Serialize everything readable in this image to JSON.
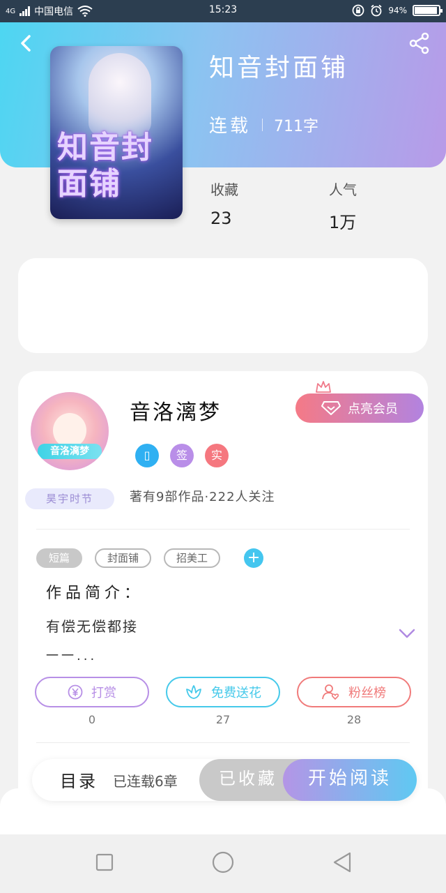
{
  "status_bar": {
    "network": "4G",
    "carrier": "中国电信",
    "time": "15:23",
    "battery": "94%"
  },
  "book": {
    "title": "知音封面铺",
    "status": "连载",
    "word_count": "711字",
    "cover_title": "知音封面铺",
    "stats": [
      {
        "label": "收藏",
        "value": "23"
      },
      {
        "label": "人气",
        "value": "1万"
      }
    ]
  },
  "author": {
    "name": "音洛漓梦",
    "title_badge": "昊宇时节",
    "avatar_label": "音洛漓梦",
    "vip_button": "点亮会员",
    "badges": [
      {
        "text": "▯",
        "color": "#2fb0f2"
      },
      {
        "text": "签",
        "color": "#b98ee8"
      },
      {
        "text": "实",
        "color": "#f5777f"
      }
    ],
    "description": "著有9部作品·222人关注"
  },
  "tags": [
    "短篇",
    "封面铺",
    "招美工"
  ],
  "intro": {
    "title": "作品简介：",
    "text": "有偿无偿都接",
    "more": "一一..."
  },
  "actions": [
    {
      "label": "打赏",
      "count": "0",
      "color": "#b78fe6",
      "icon": "yen-icon"
    },
    {
      "label": "免费送花",
      "count": "27",
      "color": "#45c9ea",
      "icon": "flower-icon"
    },
    {
      "label": "粉丝榜",
      "count": "28",
      "color": "#f07a7a",
      "icon": "fan-icon"
    }
  ],
  "read_bar": {
    "catalog": "目录",
    "serial_count": "已连载6章",
    "collected": "已收藏",
    "start_reading": "开始阅读"
  }
}
